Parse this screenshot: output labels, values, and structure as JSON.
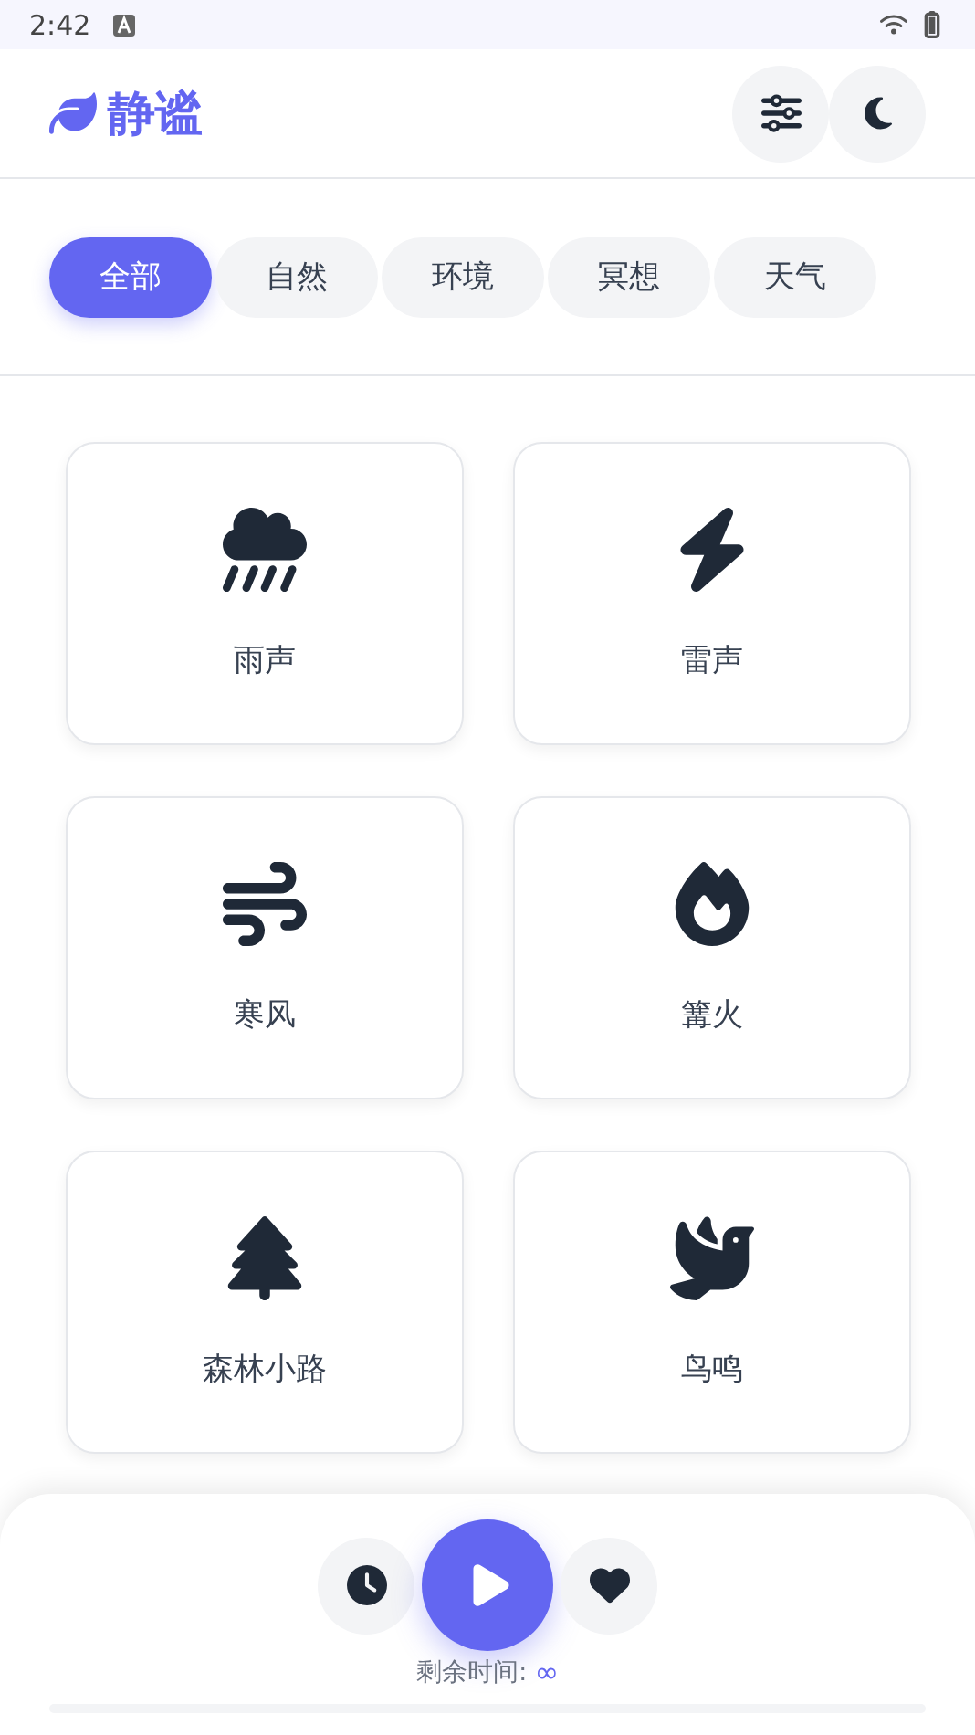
{
  "status_bar": {
    "time": "2:42"
  },
  "app": {
    "title": "静谧"
  },
  "tabs": [
    {
      "label": "全部",
      "selected": true
    },
    {
      "label": "自然",
      "selected": false
    },
    {
      "label": "环境",
      "selected": false
    },
    {
      "label": "冥想",
      "selected": false
    },
    {
      "label": "天气",
      "selected": false
    }
  ],
  "sounds": [
    {
      "name": "雨声"
    },
    {
      "name": "雷声"
    },
    {
      "name": "寒风"
    },
    {
      "name": "篝火"
    },
    {
      "name": "森林小路"
    },
    {
      "name": "鸟鸣"
    }
  ],
  "player": {
    "remaining_label": "剩余时间:",
    "remaining_value": "∞",
    "level": 0
  }
}
